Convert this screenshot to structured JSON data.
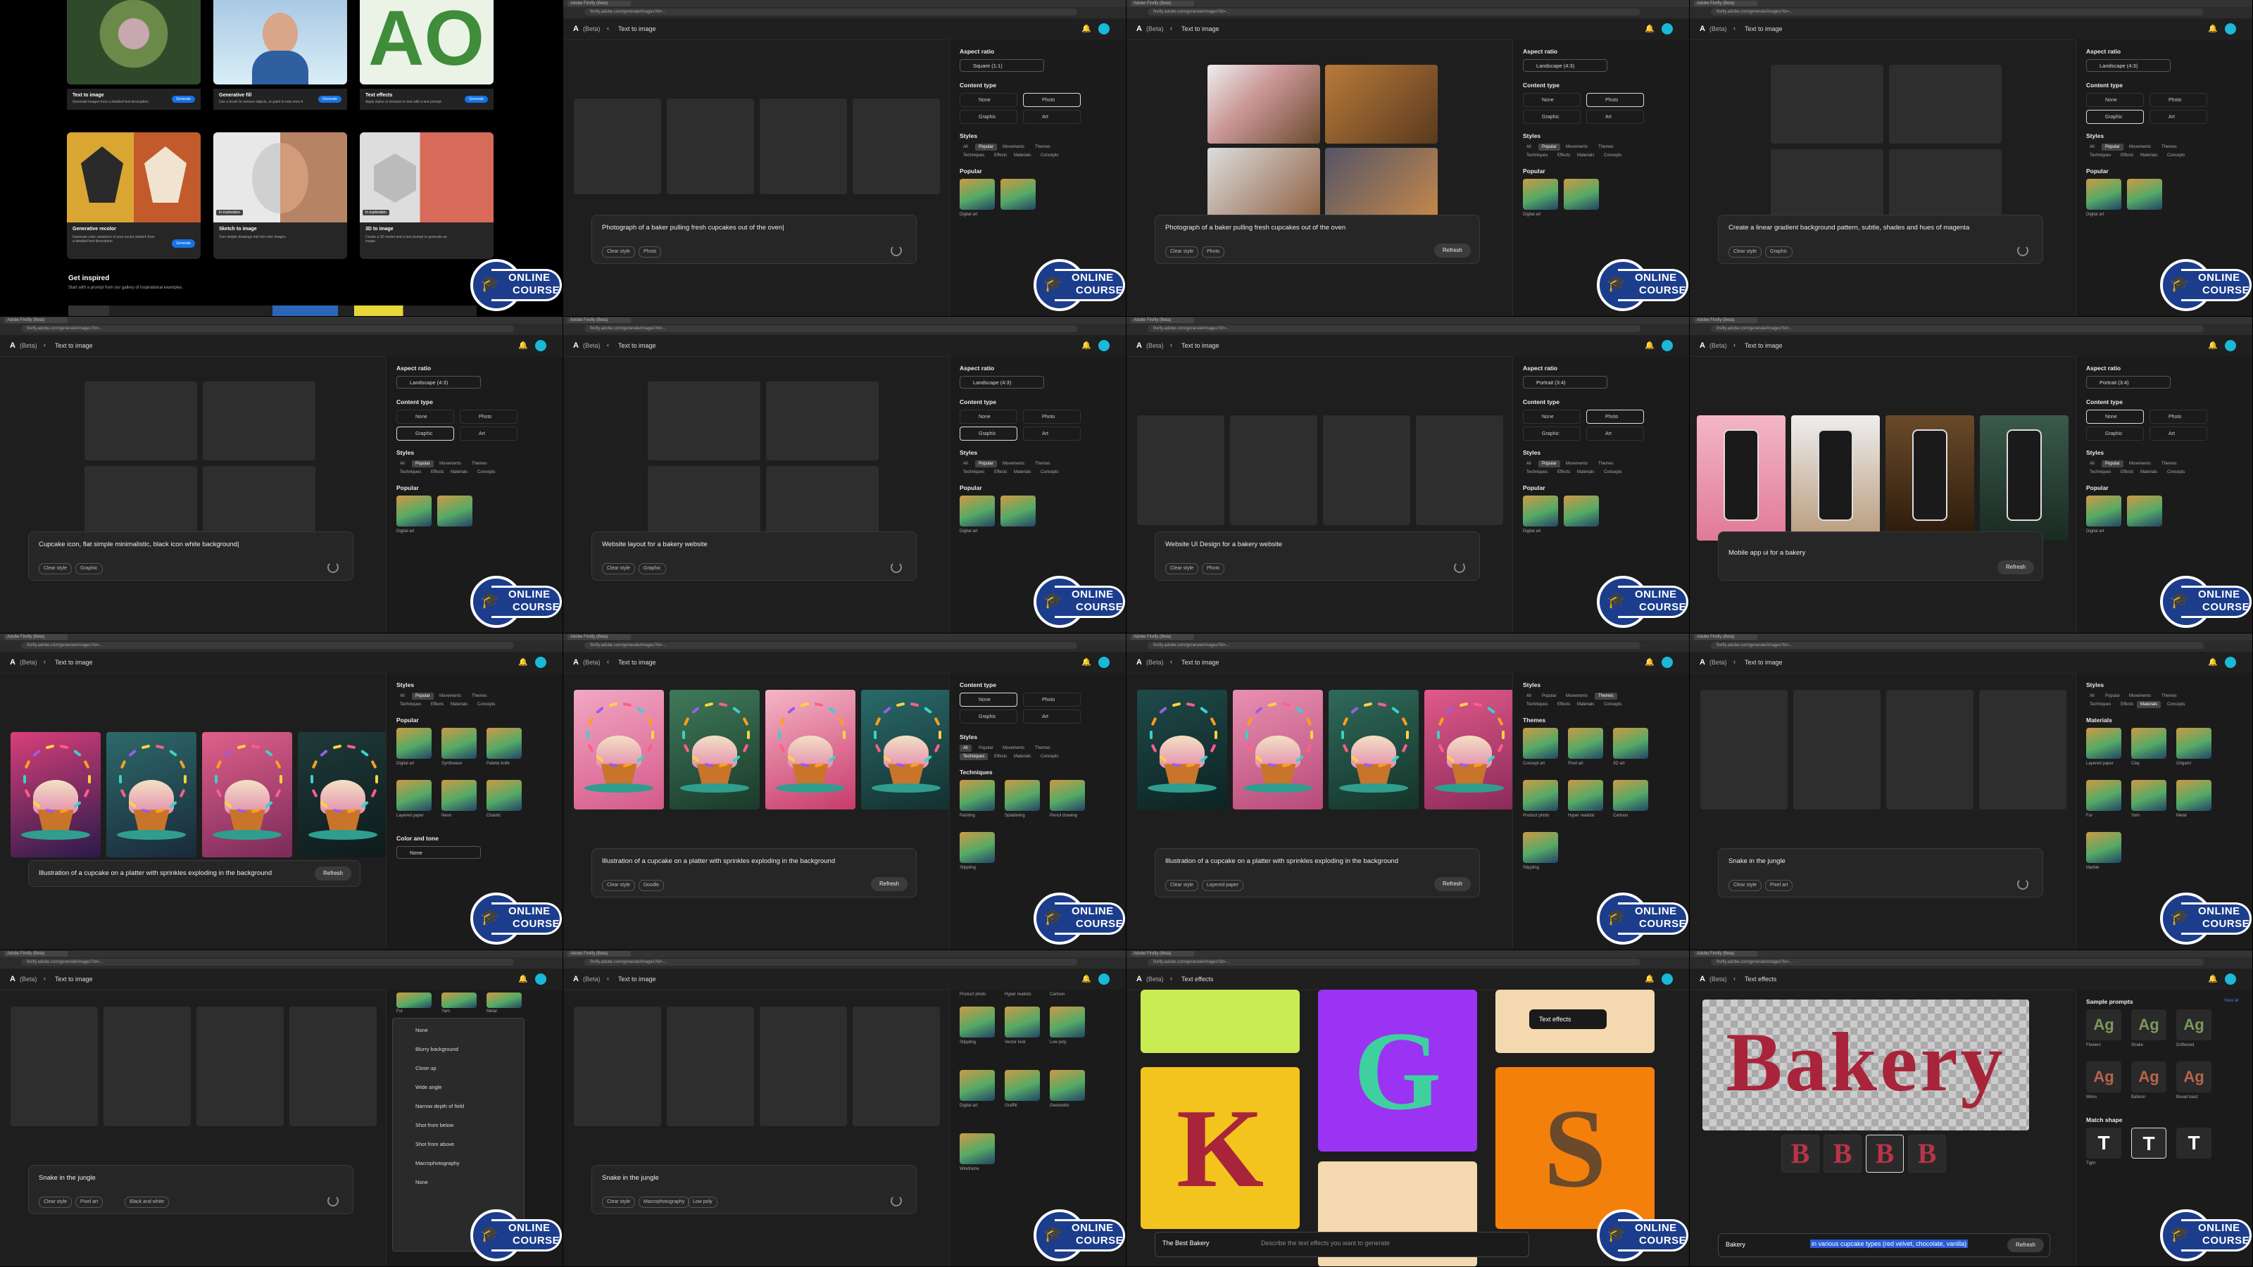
{
  "common": {
    "tab_title": "Adobe Firefly (Beta)",
    "url": "firefly.adobe.com/generate/images?id=...",
    "logo": "A",
    "beta": "(Beta)",
    "back": "‹",
    "text_to_image": "Text to image",
    "text_effects": "Text effects",
    "badge_line1": "ONLINE",
    "badge_line2": "COURSE",
    "clear_style": "Clear style",
    "refresh": "Refresh",
    "aspect_ratio": "Aspect ratio",
    "content_type": "Content type",
    "styles": "Styles",
    "popular": "Popular",
    "ct_none": "None",
    "ct_photo": "Photo",
    "ct_graphic": "Graphic",
    "ct_art": "Art",
    "seg_all": "All",
    "seg_popular": "Popular",
    "seg_movements": "Movements",
    "seg_themes": "Themes",
    "seg_techniques": "Techniques",
    "seg_effects": "Effects",
    "seg_materials": "Materials",
    "seg_concepts": "Concepts",
    "digital_art": "Digital art",
    "icon_bell": "bell-icon",
    "icon_spinner": "spinner-icon"
  },
  "home": {
    "cards": [
      {
        "title": "Text to image",
        "desc": "Generate images from a detailed text description.",
        "cta": "Generate"
      },
      {
        "title": "Generative fill",
        "desc": "Use a brush to remove objects, or paint in new ones from text descriptions.",
        "cta": "Generate"
      },
      {
        "title": "Text effects",
        "desc": "Apply styles or textures to text with a text prompt.",
        "cta": "Generate"
      },
      {
        "title": "Generative recolor",
        "desc": "Generate color variations of your vector artwork from a detailed text description.",
        "cta": "Generate"
      },
      {
        "title": "Sketch to image",
        "desc": "Turn simple drawings into full-color images.",
        "cta": ""
      },
      {
        "title": "3D to image",
        "desc": "Create a 3D model and a text prompt to generate an image.",
        "cta": ""
      }
    ],
    "get_inspired": "Get inspired",
    "get_inspired_sub": "Start with a prompt from our gallery of inspirational examples.",
    "in_exploration": "In exploration"
  },
  "prompts": {
    "t2": "Photograph of a baker pulling fresh cupcakes out of the oven|",
    "t3": "Photograph of a baker pulling fresh cupcakes out of the oven",
    "t4": "Create a linear gradient background pattern, subtle, shades and hues of magenta",
    "t5": "Cupcake icon, flat simple minimalistic, black icon white background|",
    "t6": "Website layout for a bakery website",
    "t7": "Website UI Design for a bakery website",
    "t8": "Mobile app ui for a bakery",
    "t9": "Illustration of a cupcake on a platter with sprinkles exploding in the background",
    "t10": "Illustration of a cupcake on a platter with sprinkles exploding in the background",
    "t11": "Illustration of a cupcake on a platter with sprinkles exploding in the background",
    "t12": "Snake in the jungle",
    "t13": "Snake in the jungle",
    "t14": "Snake in the jungle",
    "t15": "The Best Bakery",
    "t15_hint": "Describe the text effects you want to generate",
    "t16": "Bakery",
    "t16_sel": "in various cupcake types (red velvet, chocolate, vanilla)"
  },
  "chips": {
    "photo": "Photo",
    "graphic": "Graphic",
    "doodle": "Doodle",
    "layered_paper": "Layered paper",
    "pixel_art": "Pixel art",
    "black_white": "Black and white",
    "macrophotography": "Macrophotography",
    "low_poly": "Low poly"
  },
  "aspect": {
    "square": "Square (1:1)",
    "landscape": "Landscape (4:3)",
    "portrait": "Portrait (3:4)"
  },
  "panel_labels": {
    "themes": "Themes",
    "techniques": "Techniques",
    "materials": "Materials",
    "color_tone": "Color and tone",
    "none": "None",
    "painting": "Painting",
    "splattering": "Splattering",
    "pencil_drawing": "Pencil drawing",
    "stippling": "Stippling",
    "concept_art": "Concept art",
    "pixel_art": "Pixel art",
    "3d_art": "3D art",
    "product_photo": "Product photo",
    "hyper_realistic": "Hyper realistic",
    "cartoon": "Cartoon",
    "layered_paper": "Layered paper",
    "clay": "Clay",
    "origami": "Origami",
    "fur": "Fur",
    "yarn": "Yarn",
    "metal": "Metal",
    "neon": "Neon",
    "chaotic": "Chaotic",
    "marble": "Marble",
    "synthwave": "Synthwave",
    "palette_knife": "Palette knife",
    "vector_look": "Vector look",
    "graffiti": "Graffiti",
    "geometric": "Geometric",
    "wireframe": "Wireframe",
    "low_poly": "Low poly",
    "digital_art": "Digital art"
  },
  "menu": {
    "items": [
      "None",
      "Blurry background",
      "Close up",
      "Wide angle",
      "Narrow depth of field",
      "Shot from below",
      "Shot from above",
      "Macrophotography",
      "None"
    ]
  },
  "text_effects": {
    "tooltip": "Text effects",
    "letters": [
      "K",
      "G",
      "S"
    ],
    "bakery_word": "Bakery",
    "sample_prompts": "Sample prompts",
    "view_all": "View all",
    "sample": [
      "Flowers",
      "Snake",
      "Driftwood",
      "Wires",
      "Balloon",
      "Bread toast"
    ],
    "match_shape": "Match shape",
    "tight": "Tight",
    "ag": "Ag",
    "t_glyph": "T",
    "variants": [
      "B",
      "B",
      "B",
      "B"
    ]
  },
  "colors": {
    "accent": "#1473e6",
    "badge": "#1c3d8c",
    "avatar": "#19b9d8"
  }
}
